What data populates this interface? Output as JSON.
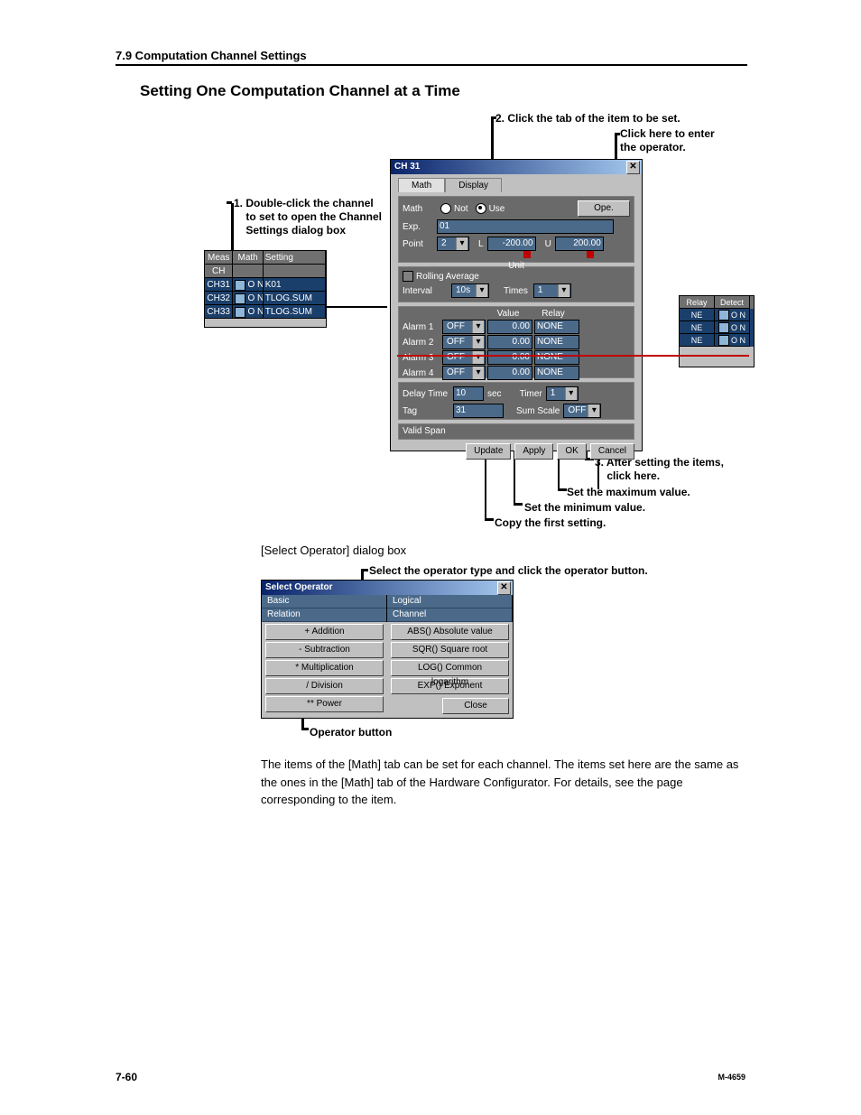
{
  "header": {
    "section": "7.9  Computation Channel Settings"
  },
  "page": {
    "num": "7-60",
    "manual": "M-4659"
  },
  "title": "Setting One Computation Channel at a Time",
  "ann": {
    "a1": "1. Double-click the channel\n    to set to open the Channel\n    Settings dialog box",
    "a2": "2. Click the tab of the item to be set.",
    "a_ope": "Click here to enter\nthe operator.",
    "a3": "3. After setting the items,\n    click here.",
    "a_max": "Set the maximum value.",
    "a_min": "Set the minimum value.",
    "a_copy": "Copy the first setting.",
    "a_sel_cap": "[Select Operator] dialog box",
    "a_selope": "Select the operator type and click the operator button.",
    "a_opbtn": "Operator button"
  },
  "chtable": {
    "cols": [
      "Meas",
      "Math",
      "Setting"
    ],
    "sub": "CH",
    "spacer": "",
    "rows": [
      {
        "ch": "CH31",
        "on": "O N",
        "set": "K01"
      },
      {
        "ch": "CH32",
        "on": "O N",
        "set": "TLOG.SUM"
      },
      {
        "ch": "CH33",
        "on": "O N",
        "set": "TLOG.SUM"
      }
    ]
  },
  "chart_data": {
    "type": "table",
    "columns": [
      "Meas",
      "Math",
      "Setting"
    ],
    "rows": [
      [
        "CH31",
        "ON",
        "K01"
      ],
      [
        "CH32",
        "ON",
        "TLOG.SUM"
      ],
      [
        "CH33",
        "ON",
        "TLOG.SUM"
      ]
    ]
  },
  "dlg": {
    "title": "CH 31",
    "tabs": {
      "math": "Math",
      "display": "Display"
    },
    "mathrow": {
      "lbl": "Math",
      "not": "Not",
      "use": "Use",
      "ope": "Ope."
    },
    "exp": {
      "lbl": "Exp.",
      "val": "01"
    },
    "point": {
      "lbl": "Point",
      "val": "2",
      "L": "L",
      "Lval": "-200.00",
      "U": "U",
      "Uval": "200.00"
    },
    "unit": "Unit",
    "roll": {
      "lbl": "Rolling Average",
      "int": "Interval",
      "intv": "10s",
      "times": "Times",
      "tv": "1"
    },
    "alhdr": {
      "value": "Value",
      "relay": "Relay"
    },
    "alarms": [
      {
        "n": "Alarm 1",
        "t": "OFF",
        "v": "0.00",
        "r": "NONE"
      },
      {
        "n": "Alarm 2",
        "t": "OFF",
        "v": "0.00",
        "r": "NONE"
      },
      {
        "n": "Alarm 3",
        "t": "OFF",
        "v": "0.00",
        "r": "NONE"
      },
      {
        "n": "Alarm 4",
        "t": "OFF",
        "v": "0.00",
        "r": "NONE"
      }
    ],
    "delay": {
      "lbl": "Delay Time",
      "v": "10",
      "sec": "sec",
      "timer": "Timer",
      "tv": "1"
    },
    "tag": {
      "lbl": "Tag",
      "v": "31",
      "sum": "Sum Scale",
      "sv": "OFF"
    },
    "valspan": "Valid Span",
    "btns": {
      "update": "Update",
      "apply": "Apply",
      "ok": "OK",
      "cancel": "Cancel"
    }
  },
  "relay": {
    "cols": [
      "Relay",
      "Detect"
    ],
    "rows": [
      {
        "r": "NE",
        "d": "O N"
      },
      {
        "r": "NE",
        "d": "O N"
      },
      {
        "r": "NE",
        "d": "O N"
      }
    ]
  },
  "sop": {
    "title": "Select Operator",
    "cats": {
      "basic": "Basic",
      "relation": "Relation",
      "logical": "Logical",
      "channel": "Channel"
    },
    "left": [
      "+ Addition",
      "- Subtraction",
      "* Multiplication",
      "/ Division",
      "** Power"
    ],
    "right": [
      "ABS() Absolute value",
      "SQR() Square root",
      "LOG() Common logarithm",
      "EXP() Exponent",
      "Close"
    ]
  },
  "body": "The items of the [Math] tab can be set for each channel.  The items set here are the same as the ones in the [Math] tab of the Hardware Configurator.  For details, see the page corresponding to the item."
}
